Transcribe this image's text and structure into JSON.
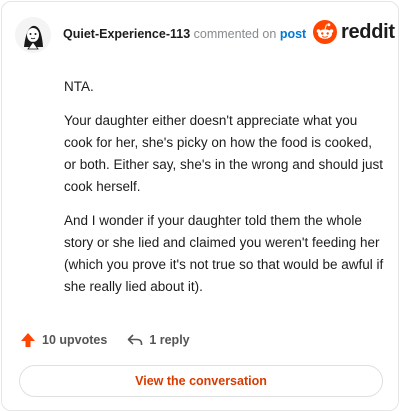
{
  "comment": {
    "username": "Quiet-Experience-113",
    "action_text": "commented on",
    "post_link_label": "post",
    "brand": "reddit",
    "paragraphs": [
      "NTA.",
      "Your daughter either doesn't appreciate what you cook for her, she's picky on how the food is cooked, or both. Either say, she's in the wrong and should just cook herself.",
      "And I wonder if your daughter told them the whole story or she lied and claimed you weren't feeding her (which you prove it's not true so that would be awful if she really lied about it)."
    ],
    "upvotes_label": "10 upvotes",
    "replies_label": "1 reply",
    "view_button_label": "View the conversation"
  },
  "colors": {
    "upvote": "#ff4500",
    "link": "#0079d3",
    "button_text": "#d93a00"
  },
  "icons": [
    "avatar",
    "reddit-snoo-icon",
    "upvote-arrow-icon",
    "reply-arrow-icon"
  ]
}
